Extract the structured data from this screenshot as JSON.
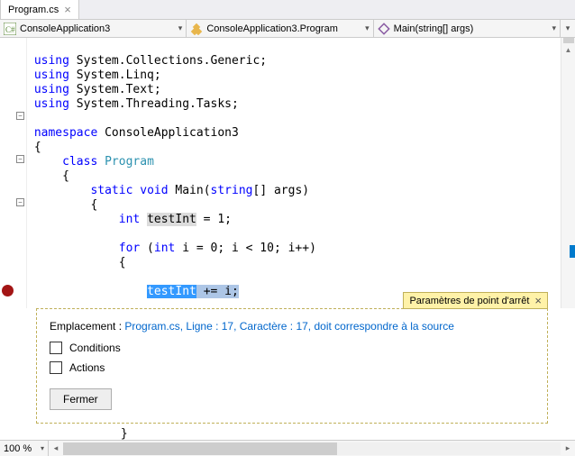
{
  "tab": {
    "name": "Program.cs",
    "close": "×"
  },
  "nav": {
    "project": "ConsoleApplication3",
    "class": "ConsoleApplication3.Program",
    "method": "Main(string[] args)"
  },
  "code": {
    "l1_a": "using",
    "l1_b": " System.Collections.Generic;",
    "l2_a": "using",
    "l2_b": " System.Linq;",
    "l3_a": "using",
    "l3_b": " System.Text;",
    "l4_a": "using",
    "l4_b": " System.Threading.Tasks;",
    "l6_a": "namespace",
    "l6_b": " ConsoleApplication3",
    "l7": "{",
    "l8_a": "    ",
    "l8_b": "class",
    "l8_c": " ",
    "l8_d": "Program",
    "l9": "    {",
    "l10_a": "        ",
    "l10_b": "static",
    "l10_c": " ",
    "l10_d": "void",
    "l10_e": " Main(",
    "l10_f": "string",
    "l10_g": "[] args)",
    "l11": "        {",
    "l12_a": "            ",
    "l12_b": "int",
    "l12_c": " ",
    "l12_d": "testInt",
    "l12_e": " = 1;",
    "l14_a": "            ",
    "l14_b": "for",
    "l14_c": " (",
    "l14_d": "int",
    "l14_e": " i = 0; i < 10; i++)",
    "l15": "            {",
    "l16_a": "                ",
    "l16_b": "testInt",
    "l16_c": " ",
    "l16_d": "+= i;",
    "tail": "            }"
  },
  "bp": {
    "title": "Paramètres de point d'arrêt",
    "close": "×",
    "loc_label": "Emplacement : ",
    "loc_link": "Program.cs, Ligne : 17, Caractère : 17, doit correspondre à la source",
    "conditions": "Conditions",
    "actions": "Actions",
    "close_btn": "Fermer"
  },
  "zoom": "100 %"
}
